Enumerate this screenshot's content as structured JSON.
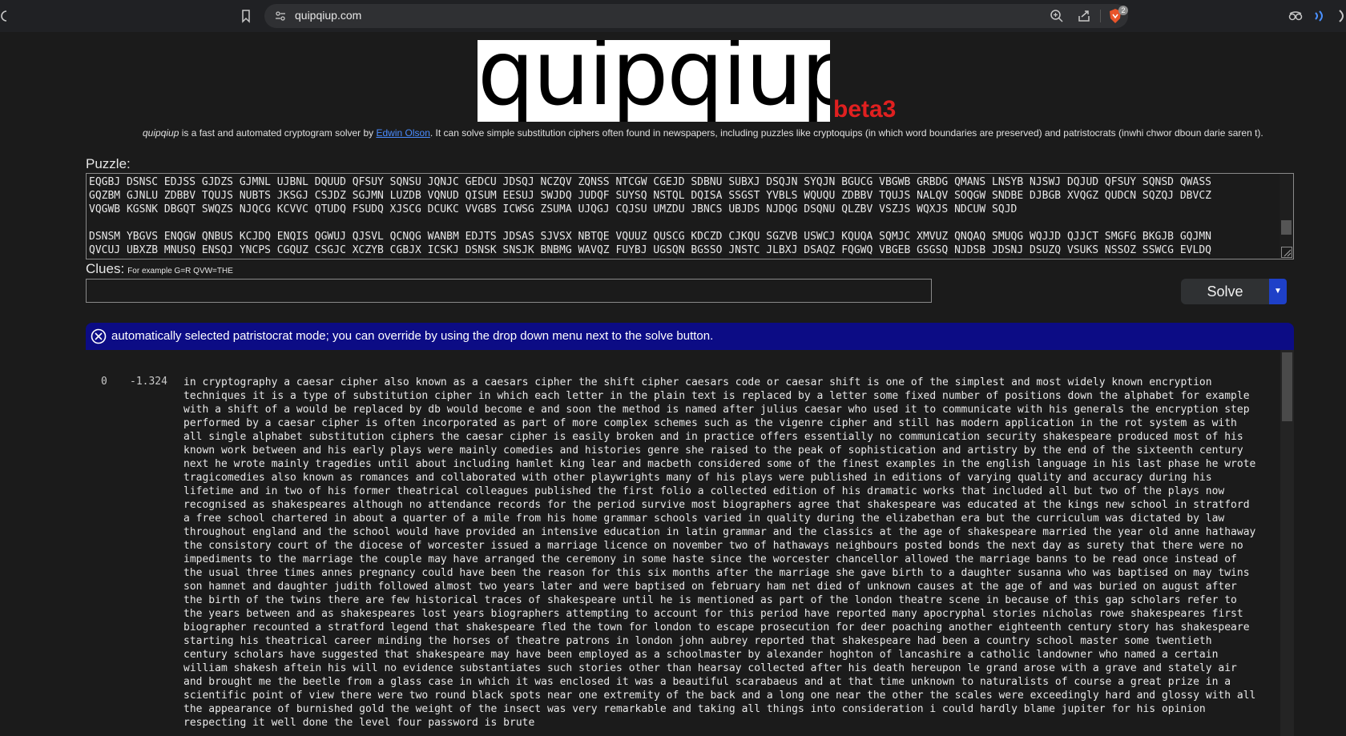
{
  "browser": {
    "url": "quipqiup.com",
    "brave_badge": "2"
  },
  "header": {
    "logo_text": "quipqiup",
    "beta": "beta3",
    "tagline_name": "quipqiup",
    "tagline_mid": " is a fast and automated cryptogram solver by ",
    "author_link": "Edwin Olson",
    "tagline_rest": ". It can solve simple substitution ciphers often found in newspapers, including puzzles like cryptoquips (in which word boundaries are preserved) and patristocrats (inwhi chwor dboun darie saren t)."
  },
  "puzzle": {
    "label": "Puzzle:",
    "text": "EQGBJ DSNSC EDJSS GJDZS GJMNL UJBNL DQUUD QFSUY SQNSU JQNJC GEDCU JDSQJ NCZQV ZQNSS NTCGW CGEJD SDBNU SUBXJ DSQJN SYQJN BGUCG VBGWB GRBDG QMANS LNSYB NJSWJ DQJUD QFSUY SQNSD QWASS\nGQZBM GJNLU ZDBBV TQUJS NUBTS JKSGJ CSJDZ SGJMN LUZDB VQNUD QISUM EESUJ SWJDQ JUDQF SUYSQ NSTQL DQISA SSGST YVBLS WQUQU ZDBBV TQUJS NALQV SOQGW SNDBE DJBGB XVQGZ QUDCN SQZQJ DBVCZ\nVQGWB KGSNK DBGQT SWQZS NJQCG KCVVC QTUDQ FSUDQ XJSCG DCUKC VVGBS ICWSG ZSUMA UJQGJ CQJSU UMZDU JBNCS UBJDS NJDQG DSQNU QLZBV VSZJS WQXJS NDCUW SQJD\n\nDSNSM YBGVS ENQGW QNBUS KCJDQ ENQIS QGWUJ QJSVL QCNQG WANBM EDJTS JDSAS SJVSX NBTQE VQUUZ QUSCG KDCZD CJKQU SGZVB USWCJ KQUQA SQMJC XMVUZ QNQAQ SMUQG WQJJD QJJCT SMGFG BKGJB GQJMN\nQVCUJ UBXZB MNUSQ ENSQJ YNCPS CGQUZ CSGJC XCZYB CGBJX ICSKJ DSNSK SNSJK BNBMG WAVQZ FUYBJ UGSQN BGSSO JNSTC JLBXJ DSAQZ FQGWQ VBGEB GSGSQ NJDSB JDSNJ DSUZQ VSUKS NSSOZ SSWCG EVLDQ"
  },
  "clues": {
    "label": "Clues:",
    "example": "For example G=R QVW=THE",
    "value": ""
  },
  "solve": {
    "label": "Solve",
    "dropdown": "▼"
  },
  "alert": {
    "message": "automatically selected patristocrat mode; you can override by using the drop down menu next to the solve button."
  },
  "result": {
    "rank": "0",
    "score": "-1.324",
    "text": "in cryptography a caesar cipher also known as a caesars cipher the shift cipher caesars code or caesar shift is one of the simplest and most widely known encryption\ntechniques it is a type of substitution cipher in which each letter in the plain text is replaced by a letter some fixed number of positions down the alphabet for example\nwith a shift of a would be replaced by db would become e and soon the method is named after julius caesar who used it to communicate with his generals the encryption step\nperformed by a caesar cipher is often incorporated as part of more complex schemes such as the vigenre cipher and still has modern application in the rot system as with\nall single alphabet substitution ciphers the caesar cipher is easily broken and in practice offers essentially no communication security shakespeare produced most of his\nknown work between and his early plays were mainly comedies and histories genre she raised to the peak of sophistication and artistry by the end of the sixteenth century\nnext he wrote mainly tragedies until about including hamlet king lear and macbeth considered some of the finest examples in the english language in his last phase he wrote\ntragicomedies also known as romances and collaborated with other playwrights many of his plays were published in editions of varying quality and accuracy during his\nlifetime and in two of his former theatrical colleagues published the first folio a collected edition of his dramatic works that included all but two of the plays now\nrecognised as shakespeares although no attendance records for the period survive most biographers agree that shakespeare was educated at the kings new school in stratford\na free school chartered in about a quarter of a mile from his home grammar schools varied in quality during the elizabethan era but the curriculum was dictated by law\nthroughout england and the school would have provided an intensive education in latin grammar and the classics at the age of shakespeare married the year old anne hathaway\nthe consistory court of the diocese of worcester issued a marriage licence on november two of hathaways neighbours posted bonds the next day as surety that there were no\nimpediments to the marriage the couple may have arranged the ceremony in some haste since the worcester chancellor allowed the marriage banns to be read once instead of\nthe usual three times annes pregnancy could have been the reason for this six months after the marriage she gave birth to a daughter susanna who was baptised on may twins\nson hamnet and daughter judith followed almost two years later and were baptised on february ham net died of unknown causes at the age of and was buried on august after\nthe birth of the twins there are few historical traces of shakespeare until he is mentioned as part of the london theatre scene in because of this gap scholars refer to\nthe years between and as shakespeares lost years biographers attempting to account for this period have reported many apocryphal stories nicholas rowe shakespeares first\nbiographer recounted a stratford legend that shakespeare fled the town for london to escape prosecution for deer poaching another eighteenth century story has shakespeare\nstarting his theatrical career minding the horses of theatre patrons in london john aubrey reported that shakespeare had been a country school master some twentieth\ncentury scholars have suggested that shakespeare may have been employed as a schoolmaster by alexander hoghton of lancashire a catholic landowner who named a certain\nwilliam shakesh aftein his will no evidence substantiates such stories other than hearsay collected after his death hereupon le grand arose with a grave and stately air\nand brought me the beetle from a glass case in which it was enclosed it was a beautiful scarabaeus and at that time unknown to naturalists of course a great prize in a\nscientific point of view there were two round black spots near one extremity of the back and a long one near the other the scales were exceedingly hard and glossy with all\nthe appearance of burnished gold the weight of the insect was very remarkable and taking all things into consideration i could hardly blame jupiter for his opinion\nrespecting it well done the level four password is brute"
  }
}
